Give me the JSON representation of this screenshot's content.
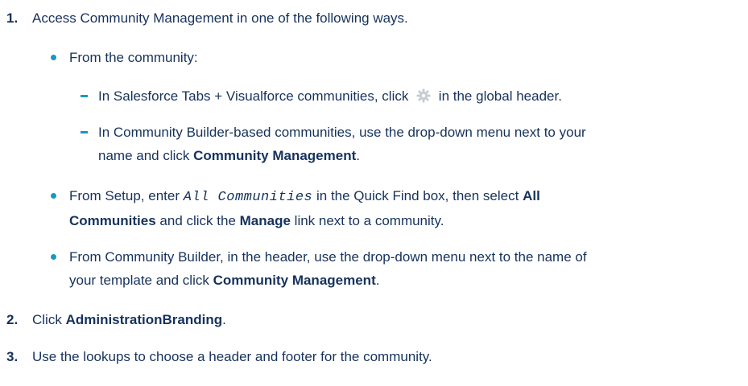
{
  "steps": [
    {
      "number": "1.",
      "text": "Access Community Management in one of the following ways."
    },
    {
      "number": "2.",
      "text_prefix": "Click ",
      "text_bold": "AdministrationBranding",
      "text_suffix": "."
    },
    {
      "number": "3.",
      "text": "Use the lookups to choose a header and footer for the community."
    }
  ],
  "bullets": {
    "from_community": {
      "text": "From the community:",
      "sub": [
        {
          "text_prefix": "In Salesforce Tabs + Visualforce communities, click",
          "icon": "gear-icon",
          "text_suffix": "in the global header."
        },
        {
          "text_line1": "In Community Builder-based communities, use the drop-down menu next to your",
          "text_line2_prefix": "name and click ",
          "text_line2_bold": "Community Management",
          "text_line2_suffix": "."
        }
      ]
    },
    "from_setup": {
      "line1_prefix": "From Setup, enter ",
      "line1_code": "All Communities",
      "line1_middle": " in the Quick Find box, then select ",
      "line1_bold": "All",
      "line2_bold": "Communities",
      "line2_middle": " and click the ",
      "line2_bold2": "Manage",
      "line2_suffix": " link next to a community."
    },
    "from_builder": {
      "line1": "From Community Builder, in the header, use the drop-down menu next to the name of",
      "line2_prefix": "your template and click ",
      "line2_bold": "Community Management",
      "line2_suffix": "."
    }
  },
  "colors": {
    "text": "#16325c",
    "accent": "#1798c1",
    "icon": "#c7cdd4"
  }
}
